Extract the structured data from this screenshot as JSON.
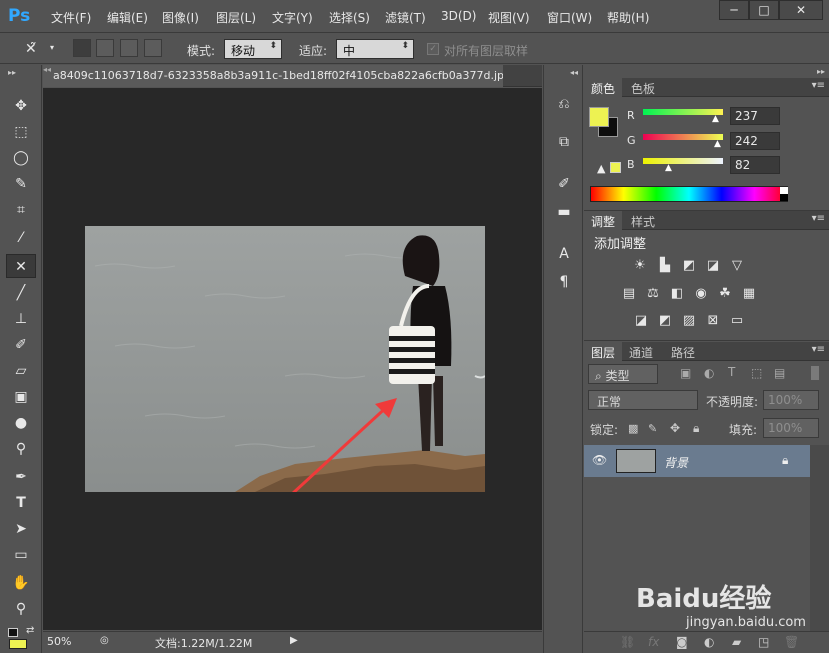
{
  "app": {
    "logo": "Ps",
    "menu": [
      "文件(F)",
      "编辑(E)",
      "图像(I)",
      "图层(L)",
      "文字(Y)",
      "选择(S)",
      "滤镜(T)",
      "3D(D)",
      "视图(V)",
      "窗口(W)",
      "帮助(H)"
    ],
    "window_buttons": [
      "─",
      "□",
      "✕"
    ]
  },
  "options": {
    "mode_label": "模式:",
    "mode_value": "移动",
    "adapt_label": "适应:",
    "adapt_value": "中",
    "sample_all_label": "对所有图层取样"
  },
  "document": {
    "tab_title": "a8409c11063718d7-6323358a8b3a911c-1bed18ff02f4105cba822a6cfb0a377d.jp",
    "zoom": "50%",
    "doc_info": "文档:1.22M/1.22M"
  },
  "color_panel": {
    "tabs": [
      "颜色",
      "色板"
    ],
    "r": "237",
    "g": "242",
    "b": "82",
    "labels": [
      "R",
      "G",
      "B"
    ],
    "fg_color": "#edf252"
  },
  "adjust_panel": {
    "tabs": [
      "调整",
      "样式"
    ],
    "heading": "添加调整"
  },
  "layers_panel": {
    "tabs": [
      "图层",
      "通道",
      "路径"
    ],
    "filter": "类型",
    "blend_mode": "正常",
    "opacity_label": "不透明度:",
    "opacity_value": "100%",
    "lock_label": "锁定:",
    "fill_label": "填充:",
    "fill_value": "100%",
    "layer_name": "背景"
  },
  "watermark": {
    "brand": "Baidu经验",
    "url": "jingyan.baidu.com"
  }
}
